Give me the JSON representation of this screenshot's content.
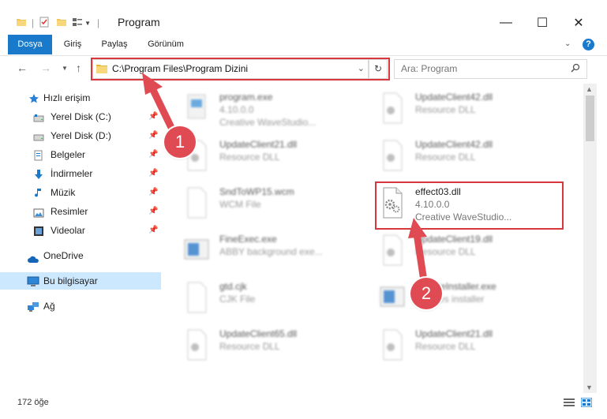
{
  "window": {
    "title": "Program",
    "minimize": "—",
    "maximize": "☐",
    "close": "✕"
  },
  "ribbon": {
    "tabs": [
      {
        "label": "Dosya",
        "active": true
      },
      {
        "label": "Giriş"
      },
      {
        "label": "Paylaş"
      },
      {
        "label": "Görünüm"
      }
    ],
    "help": "?"
  },
  "address": {
    "path": "C:\\Program Files\\Program Dizini",
    "refresh": "↻"
  },
  "search": {
    "placeholder": "Ara: Program"
  },
  "sidebar": {
    "items": [
      {
        "label": "Hızlı erişim",
        "icon": "star-icon"
      },
      {
        "label": "Yerel Disk (C:)",
        "icon": "drive-icon"
      },
      {
        "label": "Yerel Disk (D:)",
        "icon": "drive-icon"
      },
      {
        "label": "Belgeler",
        "icon": "documents-icon"
      },
      {
        "label": "İndirmeler",
        "icon": "download-icon"
      },
      {
        "label": "Müzik",
        "icon": "music-icon"
      },
      {
        "label": "Resimler",
        "icon": "pictures-icon"
      },
      {
        "label": "Videolar",
        "icon": "video-icon"
      },
      {
        "label": "OneDrive",
        "icon": "cloud-icon"
      },
      {
        "label": "Bu bilgisayar",
        "icon": "computer-icon"
      },
      {
        "label": "Ağ",
        "icon": "network-icon"
      }
    ]
  },
  "files": [
    {
      "name": "program.exe",
      "line1": "4.10.0.0",
      "line2": "Creative WaveStudio..."
    },
    {
      "name": "UpdateClient42.dll",
      "line1": "Resource DLL",
      "line2": ""
    },
    {
      "name": "UpdateClient21.dll",
      "line1": "Resource DLL",
      "line2": ""
    },
    {
      "name": "UpdateClient42.dll",
      "line1": "Resource DLL",
      "line2": ""
    },
    {
      "name": "SndToWP15.wcm",
      "line1": "WCM File",
      "line2": ""
    },
    {
      "name": "effect03.dll",
      "line1": "4.10.0.0",
      "line2": "Creative WaveStudio..."
    },
    {
      "name": "FineExec.exe",
      "line1": "ABBY background exe...",
      "line2": ""
    },
    {
      "name": "UpdateClient19.dll",
      "line1": "Resource DLL",
      "line2": ""
    },
    {
      "name": "gtd.cjk",
      "line1": "CJK File",
      "line2": ""
    },
    {
      "name": "UpdateInstaller.exe",
      "line1": "updates installer",
      "line2": ""
    },
    {
      "name": "UpdateClient65.dll",
      "line1": "Resource DLL",
      "line2": ""
    },
    {
      "name": "UpdateClient21.dll",
      "line1": "Resource DLL",
      "line2": ""
    }
  ],
  "status": {
    "count": "172 öğe"
  },
  "annotations": {
    "step1": "1",
    "step2": "2",
    "color": "#d9373e"
  },
  "colors": {
    "accent": "#1979ca",
    "selected": "#cce8ff"
  }
}
